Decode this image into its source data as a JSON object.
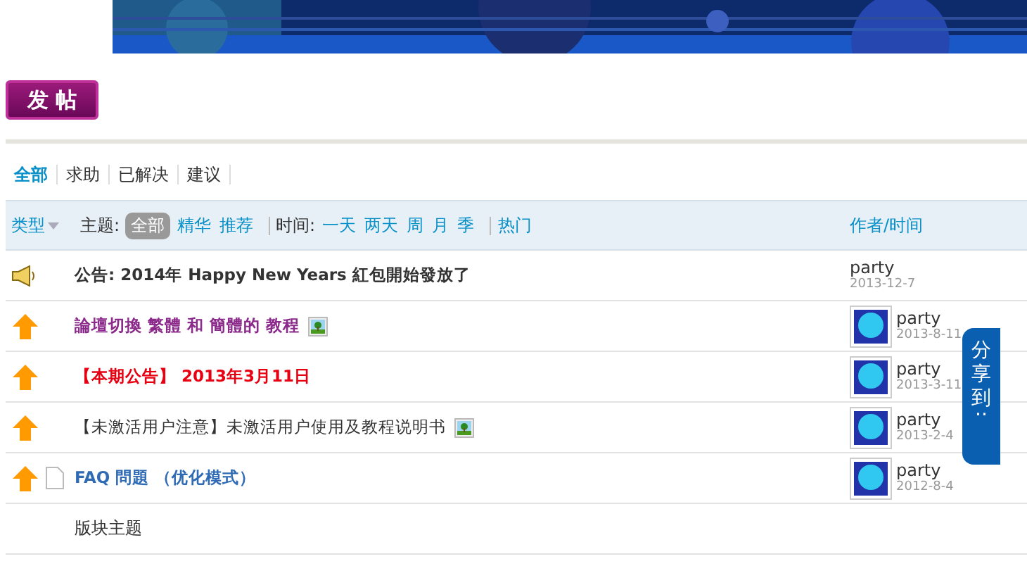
{
  "post_button": {
    "label": "发 帖"
  },
  "type_tabs": [
    {
      "label": "全部",
      "selected": true
    },
    {
      "label": "求助",
      "selected": false
    },
    {
      "label": "已解决",
      "selected": false
    },
    {
      "label": "建议",
      "selected": false
    }
  ],
  "filter_bar": {
    "type_label": "类型",
    "topic_label": "主题:",
    "topics": [
      {
        "label": "全部",
        "selected": true
      },
      {
        "label": "精华",
        "selected": false
      },
      {
        "label": "推荐",
        "selected": false
      }
    ],
    "time_label": "时间:",
    "times": [
      "一天",
      "两天",
      "周",
      "月",
      "季"
    ],
    "hot": "热门",
    "author_header": "作者/时间"
  },
  "threads": [
    {
      "kind": "announcement",
      "title": "公告: 2014年 Happy New Years 紅包開始發放了",
      "color": "#333333",
      "bold": true,
      "has_image": false,
      "file_icon": false,
      "avatar": false,
      "author": "party",
      "date": "2013-12-7"
    },
    {
      "kind": "sticky",
      "title": "論壇切換 繁體 和 簡體的 教程",
      "color": "#8b2a8b",
      "bold": true,
      "has_image": true,
      "file_icon": false,
      "avatar": true,
      "author": "party",
      "date": "2013-8-11"
    },
    {
      "kind": "sticky",
      "title": "【本期公告】 2013年3月11日",
      "color": "#e60012",
      "bold": true,
      "has_image": false,
      "file_icon": false,
      "avatar": true,
      "author": "party",
      "date": "2013-3-11"
    },
    {
      "kind": "sticky",
      "title": "【未激活用户注意】未激活用户使用及教程说明书",
      "color": "#333333",
      "bold": false,
      "has_image": true,
      "file_icon": false,
      "avatar": true,
      "author": "party",
      "date": "2013-2-4"
    },
    {
      "kind": "sticky",
      "title": "FAQ 問題 （优化模式）",
      "color": "#2f6bb5",
      "bold": true,
      "has_image": false,
      "file_icon": true,
      "avatar": true,
      "author": "party",
      "date": "2012-8-4"
    }
  ],
  "section_label": "版块主题",
  "share_tab": {
    "label": "分享到",
    "dots": "··"
  }
}
